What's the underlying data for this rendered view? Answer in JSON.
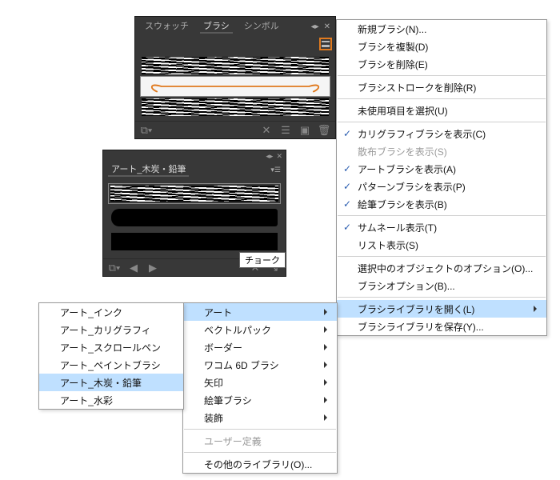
{
  "brushes_panel": {
    "tabs": {
      "swatches": "スウォッチ",
      "brushes": "ブラシ",
      "symbols": "シンボル"
    }
  },
  "charcoal_panel": {
    "title": "アート_木炭・鉛筆",
    "tooltip": "チョーク"
  },
  "flyout_menu": {
    "new_brush": "新規ブラシ(N)...",
    "dup_brush": "ブラシを複製(D)",
    "del_brush": "ブラシを削除(E)",
    "remove_stroke": "ブラシストロークを削除(R)",
    "select_unused": "未使用項目を選択(U)",
    "show_calli": "カリグラフィブラシを表示(C)",
    "show_scatter": "散布ブラシを表示(S)",
    "show_art": "アートブラシを表示(A)",
    "show_pattern": "パターンブラシを表示(P)",
    "show_bristle": "絵筆ブラシを表示(B)",
    "thumb_view": "サムネール表示(T)",
    "list_view": "リスト表示(S)",
    "sel_options": "選択中のオブジェクトのオプション(O)...",
    "brush_options": "ブラシオプション(B)...",
    "open_lib": "ブラシライブラリを開く(L)",
    "save_lib": "ブラシライブラリを保存(Y)..."
  },
  "lib_menu": {
    "art": "アート",
    "vector": "ベクトルパック",
    "border": "ボーダー",
    "wacom": "ワコム 6D ブラシ",
    "arrow": "矢印",
    "bristle": "絵筆ブラシ",
    "deco": "装飾",
    "user": "ユーザー定義",
    "other": "その他のライブラリ(O)..."
  },
  "art_menu": {
    "ink": "アート_インク",
    "calli": "アート_カリグラフィ",
    "scroll": "アート_スクロールペン",
    "paint": "アート_ペイントブラシ",
    "charcoal": "アート_木炭・鉛筆",
    "water": "アート_水彩"
  }
}
